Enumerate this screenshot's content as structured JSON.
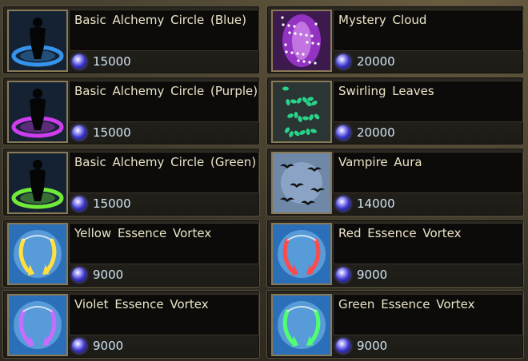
{
  "currency_icon": "essence-orb-icon",
  "items": [
    {
      "name": "Basic Alchemy Circle (Blue)",
      "price": "15000",
      "icon": "alchemy-circle-blue-icon",
      "accent": "#3aa0ff"
    },
    {
      "name": "Mystery Cloud",
      "price": "20000",
      "icon": "mystery-cloud-icon",
      "accent": "#c040ff"
    },
    {
      "name": "Basic Alchemy Circle (Purple)",
      "price": "15000",
      "icon": "alchemy-circle-purple-icon",
      "accent": "#e040ff"
    },
    {
      "name": "Swirling Leaves",
      "price": "20000",
      "icon": "swirling-leaves-icon",
      "accent": "#2ad38a"
    },
    {
      "name": "Basic Alchemy Circle (Green)",
      "price": "15000",
      "icon": "alchemy-circle-green-icon",
      "accent": "#7cff3a"
    },
    {
      "name": "Vampire Aura",
      "price": "14000",
      "icon": "vampire-aura-icon",
      "accent": "#9fb8d8"
    },
    {
      "name": "Yellow Essence Vortex",
      "price": "9000",
      "icon": "yellow-essence-vortex-icon",
      "accent": "#ffe040"
    },
    {
      "name": "Red Essence Vortex",
      "price": "9000",
      "icon": "red-essence-vortex-icon",
      "accent": "#ff4a4a"
    },
    {
      "name": "Violet Essence Vortex",
      "price": "9000",
      "icon": "violet-essence-vortex-icon",
      "accent": "#c86cff"
    },
    {
      "name": "Green Essence Vortex",
      "price": "9000",
      "icon": "green-essence-vortex-icon",
      "accent": "#50ff70"
    }
  ]
}
